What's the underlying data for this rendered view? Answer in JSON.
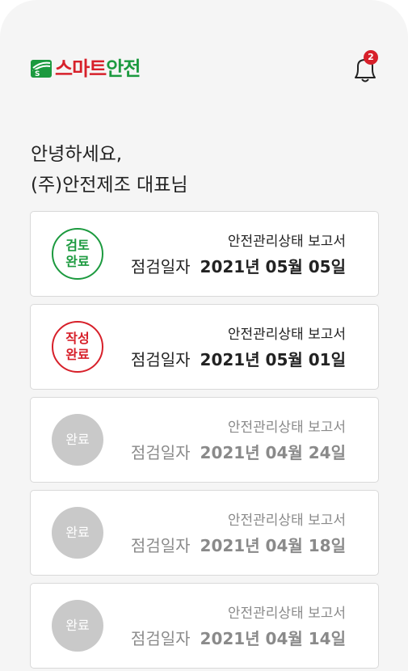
{
  "header": {
    "logo_text_part1": "스마트",
    "logo_text_part2": "안전",
    "notification_count": "2"
  },
  "greeting": {
    "line1": "안녕하세요,",
    "line2": "(주)안전제조 대표님"
  },
  "reports": [
    {
      "status_line1": "검토",
      "status_line2": "완료",
      "title": "안전관리상태 보고서",
      "date_label": "점검일자",
      "date": "2021년 05월 05일"
    },
    {
      "status_line1": "작성",
      "status_line2": "완료",
      "title": "안전관리상태 보고서",
      "date_label": "점검일자",
      "date": "2021년 05월 01일"
    },
    {
      "status_line1": "완료",
      "status_line2": "",
      "title": "안전관리상태 보고서",
      "date_label": "점검일자",
      "date": "2021년 04월 24일"
    },
    {
      "status_line1": "완료",
      "status_line2": "",
      "title": "안전관리상태 보고서",
      "date_label": "점검일자",
      "date": "2021년 04월 18일"
    },
    {
      "status_line1": "완료",
      "status_line2": "",
      "title": "안전관리상태 보고서",
      "date_label": "점검일자",
      "date": "2021년 04월 14일"
    }
  ],
  "colors": {
    "brand_red": "#d7202a",
    "brand_green": "#1c9a3f",
    "done_grey": "#c9c9c9"
  }
}
